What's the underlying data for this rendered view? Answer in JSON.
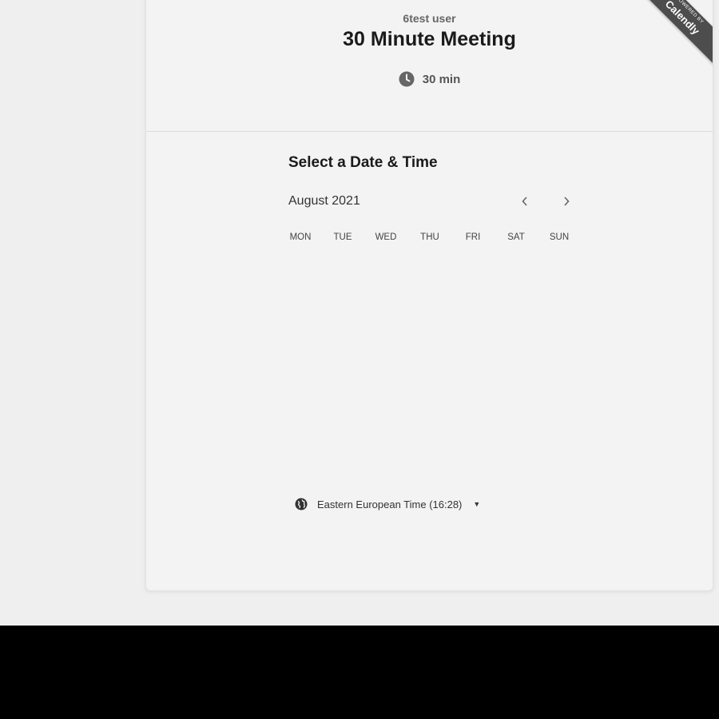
{
  "header": {
    "organizer": "6test user",
    "event_title": "30 Minute Meeting",
    "duration": "30 min",
    "duration_icon": "clock-icon"
  },
  "ribbon": {
    "small_text": "POWERED BY",
    "brand": "Calendly"
  },
  "scheduler": {
    "section_title": "Select a Date & Time",
    "month_label": "August 2021",
    "prev_icon": "chevron-left-icon",
    "next_icon": "chevron-right-icon",
    "weekdays": [
      "MON",
      "TUE",
      "WED",
      "THU",
      "FRI",
      "SAT",
      "SUN"
    ]
  },
  "timezone": {
    "icon": "globe-icon",
    "label": "Eastern European Time (16:28)",
    "dropdown_icon": "caret-down-icon"
  },
  "colors": {
    "page_bg": "#efefef",
    "card_bg": "#f3f3f3",
    "ribbon_bg": "#4d4d4d",
    "bottom_band": "#000000"
  }
}
